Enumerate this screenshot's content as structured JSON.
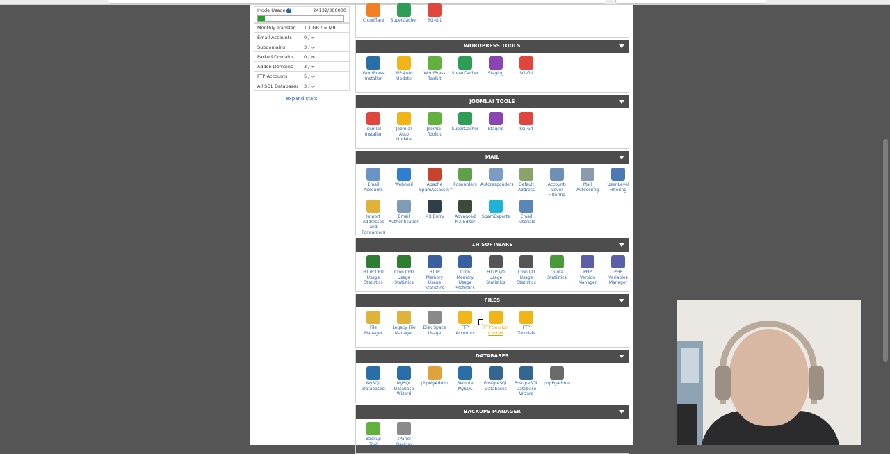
{
  "stats": {
    "inode_label": "Inode Usage",
    "inode_value": "24132/300000",
    "inode_fraction": 0.08,
    "rows": [
      {
        "label": "Monthly Transfer",
        "value": "1.1 GB / ∞ MB"
      },
      {
        "label": "Email Accounts",
        "value": "0 / ∞"
      },
      {
        "label": "Subdomains",
        "value": "3 / ∞"
      },
      {
        "label": "Parked Domains",
        "value": "0 / ∞"
      },
      {
        "label": "Addon Domains",
        "value": "3 / ∞"
      },
      {
        "label": "FTP Accounts",
        "value": "5 / ∞"
      },
      {
        "label": "All SQL Databases",
        "value": "3 / ∞"
      }
    ],
    "expand_label": "expand stats"
  },
  "top_items": [
    {
      "label": "Cloudflare",
      "icon": "cloudflare-icon",
      "color": "#f38020"
    },
    {
      "label": "SuperCacher",
      "icon": "supercacher-icon",
      "color": "#2e9e57"
    },
    {
      "label": "SG-Git",
      "icon": "sg-git-icon",
      "color": "#e0463e"
    }
  ],
  "sections": [
    {
      "title": "WORDPRESS TOOLS",
      "items": [
        {
          "label": "WordPress\nInstaller",
          "icon": "wordpress-icon",
          "color": "#2a6ea8"
        },
        {
          "label": "WP Auto\nUpdate",
          "icon": "wp-auto-update-icon",
          "color": "#f2b517"
        },
        {
          "label": "WordPress\nToolkit",
          "icon": "wordpress-toolkit-icon",
          "color": "#62b13c"
        },
        {
          "label": "SuperCacher",
          "icon": "supercacher-icon",
          "color": "#2e9e57"
        },
        {
          "label": "Staging",
          "icon": "staging-icon",
          "color": "#8b45b3"
        },
        {
          "label": "SG-Git",
          "icon": "sg-git-icon",
          "color": "#e0463e"
        }
      ]
    },
    {
      "title": "JOOMLA! TOOLS",
      "items": [
        {
          "label": "Joomla!\nInstaller",
          "icon": "joomla-icon",
          "color": "#e0463e"
        },
        {
          "label": "Joomla!\nAuto\nUpdate",
          "icon": "joomla-auto-update-icon",
          "color": "#f2b517"
        },
        {
          "label": "Joomla!\nToolkit",
          "icon": "joomla-toolkit-icon",
          "color": "#62b13c"
        },
        {
          "label": "SuperCacher",
          "icon": "supercacher-icon",
          "color": "#2e9e57"
        },
        {
          "label": "Staging",
          "icon": "staging-icon",
          "color": "#8b45b3"
        },
        {
          "label": "SG-Git",
          "icon": "sg-git-icon",
          "color": "#e0463e"
        }
      ]
    },
    {
      "title": "MAIL",
      "items": [
        {
          "label": "Email\nAccounts",
          "icon": "envelope-icon",
          "color": "#6a93c7"
        },
        {
          "label": "Webmail",
          "icon": "webmail-globe-icon",
          "color": "#2f7fd1"
        },
        {
          "label": "Apache\nSpamAssassin™",
          "icon": "spamassassin-icon",
          "color": "#c8432b"
        },
        {
          "label": "Forwarders",
          "icon": "forwarders-icon",
          "color": "#5fa04a"
        },
        {
          "label": "Autoresponders",
          "icon": "autoresponder-icon",
          "color": "#7d9cc4"
        },
        {
          "label": "Default\nAddress",
          "icon": "default-address-icon",
          "color": "#8aa36b"
        },
        {
          "label": "Account-\nLevel\nFiltering",
          "icon": "account-filter-icon",
          "color": "#6f8fb5"
        },
        {
          "label": "Mail\nAutoconfig",
          "icon": "mail-autoconfig-icon",
          "color": "#8a9bb0"
        },
        {
          "label": "User-Level\nFiltering",
          "icon": "user-filter-icon",
          "color": "#4a7ab5"
        },
        {
          "label": "Import\nAddresses\nand\nForwarders",
          "icon": "import-addresses-icon",
          "color": "#e0b23a"
        },
        {
          "label": "Email\nAuthentication",
          "icon": "email-auth-icon",
          "color": "#7f9bb8"
        },
        {
          "label": "MX Entry",
          "icon": "mx-entry-icon",
          "color": "#2f3f4a"
        },
        {
          "label": "Advanced\nMX Editor",
          "icon": "mx-editor-icon",
          "color": "#3c4a3a"
        },
        {
          "label": "SpamExperts",
          "icon": "spamexperts-icon",
          "color": "#1fb3d6"
        },
        {
          "label": "Email\nTutorials",
          "icon": "email-tutorials-icon",
          "color": "#5b86b8"
        }
      ]
    },
    {
      "title": "1H SOFTWARE",
      "items": [
        {
          "label": "HTTP CPU\nUsage\nStatistics",
          "icon": "http-cpu-icon",
          "color": "#2e7d32"
        },
        {
          "label": "Cron CPU\nUsage\nStatistics",
          "icon": "cron-cpu-icon",
          "color": "#2e7d32"
        },
        {
          "label": "HTTP\nMemory\nUsage\nStatistics",
          "icon": "http-memory-icon",
          "color": "#3a5fa0"
        },
        {
          "label": "Cron\nMemory\nUsage\nStatistics",
          "icon": "cron-memory-icon",
          "color": "#3a5fa0"
        },
        {
          "label": "HTTP I/O\nUsage\nStatistics",
          "icon": "http-io-icon",
          "color": "#555555"
        },
        {
          "label": "Cron I/O\nUsage\nStatistics",
          "icon": "cron-io-icon",
          "color": "#555555"
        },
        {
          "label": "Quota\nStatistics",
          "icon": "quota-icon",
          "color": "#4a9a3a"
        },
        {
          "label": "PHP\nVersion\nManager",
          "icon": "php-version-icon",
          "color": "#5b5fa8"
        },
        {
          "label": "PHP\nVariables\nManager",
          "icon": "php-variables-icon",
          "color": "#5b5fa8"
        }
      ]
    },
    {
      "title": "FILES",
      "items": [
        {
          "label": "File\nManager",
          "icon": "file-manager-icon",
          "color": "#e0b23a"
        },
        {
          "label": "Legacy File\nManager",
          "icon": "legacy-file-manager-icon",
          "color": "#e0b23a"
        },
        {
          "label": "Disk Space\nUsage",
          "icon": "disk-space-icon",
          "color": "#8a8a8a"
        },
        {
          "label": "FTP\nAccounts",
          "icon": "ftp-accounts-icon",
          "color": "#f2b517"
        },
        {
          "label": "FTP Session\nControl",
          "icon": "ftp-session-icon",
          "color": "#f2b517"
        },
        {
          "label": "FTP\nTutorials",
          "icon": "ftp-tutorials-icon",
          "color": "#f2b517"
        }
      ]
    },
    {
      "title": "DATABASES",
      "items": [
        {
          "label": "MySQL\nDatabases",
          "icon": "mysql-icon",
          "color": "#2a6ea8"
        },
        {
          "label": "MySQL\nDatabase\nWizard",
          "icon": "mysql-wizard-icon",
          "color": "#2a6ea8"
        },
        {
          "label": "phpMyAdmin",
          "icon": "phpmyadmin-icon",
          "color": "#e0a23a"
        },
        {
          "label": "Remote\nMySQL",
          "icon": "remote-mysql-icon",
          "color": "#2a6ea8"
        },
        {
          "label": "PostgreSQL\nDatabases",
          "icon": "postgresql-icon",
          "color": "#336791"
        },
        {
          "label": "PostgreSQL\nDatabase\nWizard",
          "icon": "postgresql-wizard-icon",
          "color": "#336791"
        },
        {
          "label": "phpPgAdmin",
          "icon": "phppgadmin-icon",
          "color": "#6b6b6b"
        }
      ]
    },
    {
      "title": "BACKUPS MANAGER",
      "items": [
        {
          "label": "Backup\nTool",
          "icon": "backup-tool-icon",
          "color": "#62b13c"
        },
        {
          "label": "cPanel\nBackup",
          "icon": "cpanel-backup-icon",
          "color": "#8a8a8a"
        }
      ]
    }
  ],
  "hovered_item": "FTP Session\nControl"
}
